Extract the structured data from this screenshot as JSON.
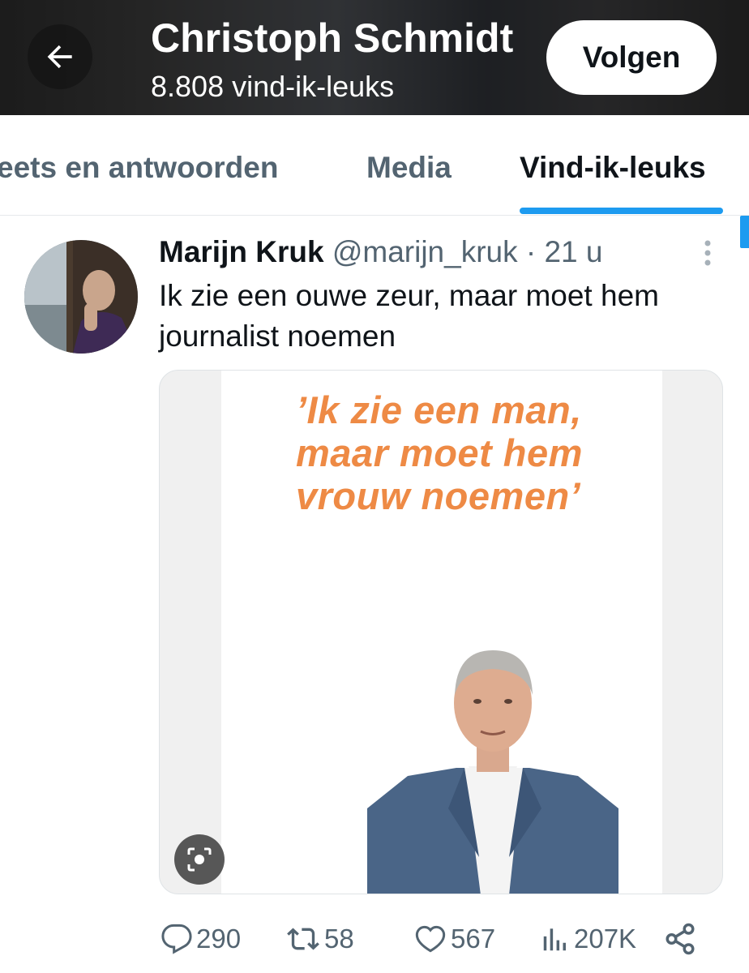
{
  "header": {
    "back_icon": "arrow-left-icon",
    "title": "Christoph Schmidt",
    "subtitle": "8.808 vind-ik-leuks",
    "follow_label": "Volgen"
  },
  "tabs": [
    {
      "label": "Tweets en antwoorden",
      "visible_text": "eets en antwoorden",
      "active": false
    },
    {
      "label": "Media",
      "active": false
    },
    {
      "label": "Vind-ik-leuks",
      "active": true
    }
  ],
  "tweet": {
    "author_name": "Marijn Kruk",
    "author_meta": "@marijn_kruk · 21 u",
    "text": "Ik zie een ouwe zeur, maar moet hem journalist noemen",
    "media": {
      "quote_lines": [
        "’Ik zie een man,",
        "maar moet hem",
        "vrouw noemen’"
      ],
      "lens_icon": "visual-search-icon"
    },
    "actions": {
      "replies": "290",
      "retweets": "58",
      "likes": "567",
      "views": "207K"
    }
  },
  "colors": {
    "accent": "#1d9bf0",
    "text_primary": "#0f1419",
    "text_secondary": "#536471",
    "quote_orange": "#ee8a45"
  }
}
